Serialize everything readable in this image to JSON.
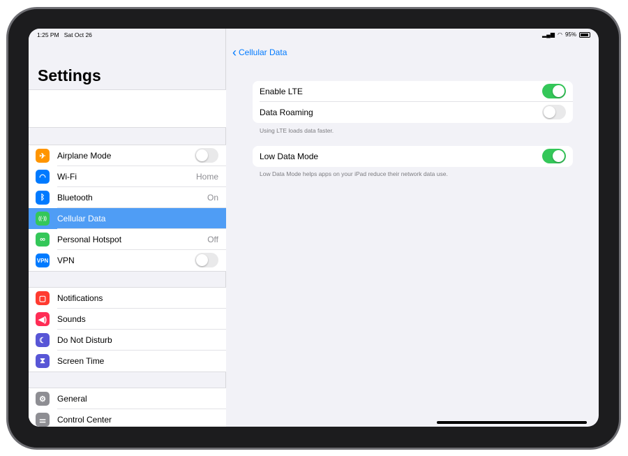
{
  "status": {
    "time": "1:25 PM",
    "date": "Sat Oct 26",
    "battery": "95%"
  },
  "sidebar": {
    "title": "Settings",
    "groups": [
      [
        {
          "label": "Airplane Mode",
          "icon": "airplane-icon",
          "color": "#ff9500",
          "toggle": false
        },
        {
          "label": "Wi-Fi",
          "icon": "wifi-icon",
          "color": "#007aff",
          "value": "Home"
        },
        {
          "label": "Bluetooth",
          "icon": "bluetooth-icon",
          "color": "#007aff",
          "value": "On"
        },
        {
          "label": "Cellular Data",
          "icon": "antenna-icon",
          "color": "#34c759",
          "selected": true
        },
        {
          "label": "Personal Hotspot",
          "icon": "hotspot-icon",
          "color": "#34c759",
          "value": "Off"
        },
        {
          "label": "VPN",
          "icon": "vpn-icon",
          "icon_text": "VPN",
          "color": "#007aff",
          "toggle": false
        }
      ],
      [
        {
          "label": "Notifications",
          "icon": "notifications-icon",
          "color": "#ff3b30"
        },
        {
          "label": "Sounds",
          "icon": "speaker-icon",
          "color": "#ff2d55"
        },
        {
          "label": "Do Not Disturb",
          "icon": "moon-icon",
          "color": "#5856d6"
        },
        {
          "label": "Screen Time",
          "icon": "hourglass-icon",
          "color": "#5856d6"
        }
      ],
      [
        {
          "label": "General",
          "icon": "gear-icon",
          "color": "#8e8e93"
        },
        {
          "label": "Control Center",
          "icon": "switches-icon",
          "color": "#8e8e93"
        }
      ]
    ]
  },
  "main": {
    "back_label": "Cellular Data",
    "group1": [
      {
        "label": "Enable LTE",
        "toggle": true
      },
      {
        "label": "Data Roaming",
        "toggle": false
      }
    ],
    "footer1": "Using LTE loads data faster.",
    "group2": [
      {
        "label": "Low Data Mode",
        "toggle": true
      }
    ],
    "footer2": "Low Data Mode helps apps on your iPad reduce their network data use."
  }
}
